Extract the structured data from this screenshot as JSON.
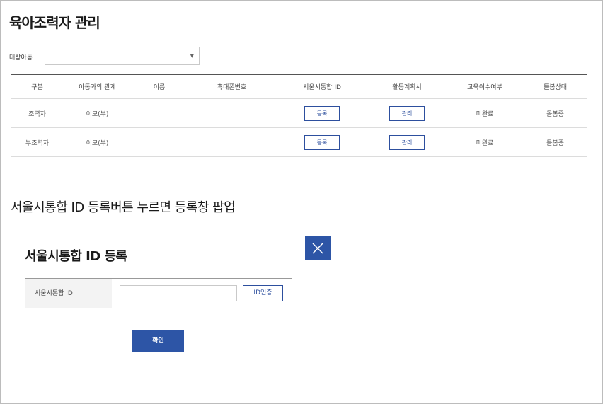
{
  "page": {
    "title": "육아조력자 관리"
  },
  "filter": {
    "label": "대상아동",
    "value": ""
  },
  "table": {
    "headers": [
      "구분",
      "아동과의 관계",
      "이름",
      "휴대폰번호",
      "서울시통합 ID",
      "활동계획서",
      "교육이수여부",
      "돌봄상태"
    ],
    "rows": [
      {
        "type": "조력자",
        "relation": "이모(부)",
        "name": "",
        "phone": "",
        "id_button": "등록",
        "plan_button": "관리",
        "education": "미완료",
        "status": "돌봄중"
      },
      {
        "type": "부조력자",
        "relation": "이모(부)",
        "name": "",
        "phone": "",
        "id_button": "등록",
        "plan_button": "관리",
        "education": "미완료",
        "status": "돌봄중"
      }
    ]
  },
  "section": {
    "caption": "서울시통합 ID 등록버튼 누르면 등록창 팝업"
  },
  "popup": {
    "title": "서울시통합 ID 등록",
    "field_label": "서울시통합 ID",
    "field_value": "",
    "verify_label": "ID인증",
    "confirm_label": "확인",
    "close_icon": "close-icon"
  },
  "colors": {
    "accent": "#2d55a6",
    "border": "#c9c9c9"
  }
}
